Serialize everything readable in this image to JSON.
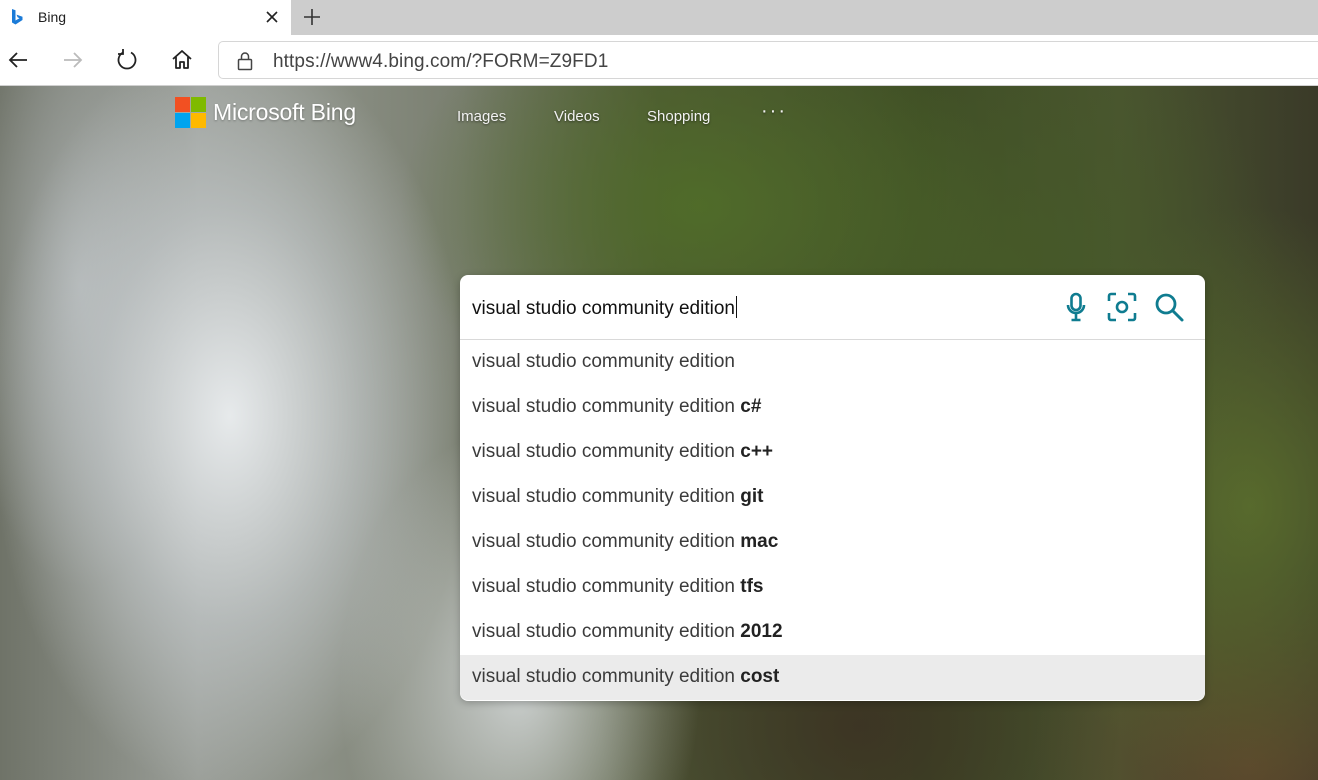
{
  "browser": {
    "tab_title": "Bing",
    "url": "https://www4.bing.com/?FORM=Z9FD1"
  },
  "brand": {
    "logo_text": "Microsoft Bing",
    "colors": {
      "red": "#f25022",
      "green": "#7fba00",
      "blue": "#00a4ef",
      "yellow": "#ffb900"
    }
  },
  "nav": {
    "images": "Images",
    "videos": "Videos",
    "shopping": "Shopping",
    "more": "···"
  },
  "search": {
    "query": "visual studio community edition",
    "accent_color": "#0f7c90",
    "icons": [
      "microphone-icon",
      "visual-search-icon",
      "search-icon"
    ]
  },
  "suggestions": [
    {
      "base": "visual studio community edition",
      "bold": ""
    },
    {
      "base": "visual studio community edition ",
      "bold": "c#"
    },
    {
      "base": "visual studio community edition ",
      "bold": "c++"
    },
    {
      "base": "visual studio community edition ",
      "bold": "git"
    },
    {
      "base": "visual studio community edition ",
      "bold": "mac"
    },
    {
      "base": "visual studio community edition ",
      "bold": "tfs"
    },
    {
      "base": "visual studio community edition ",
      "bold": "2012"
    },
    {
      "base": "visual studio community edition ",
      "bold": "cost"
    }
  ]
}
